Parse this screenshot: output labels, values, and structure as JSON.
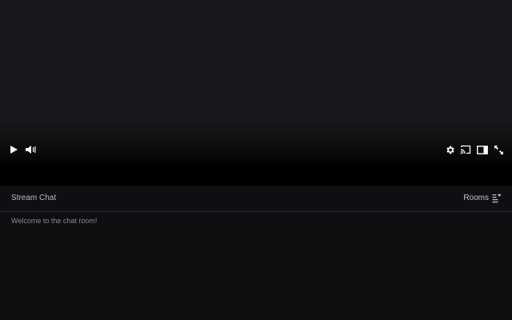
{
  "player": {
    "controls": {
      "play_icon": "play-icon",
      "volume_icon": "volume-icon",
      "settings_icon": "gear-icon",
      "cast_icon": "cast-icon",
      "theatre_icon": "theatre-mode-icon",
      "fullscreen_icon": "fullscreen-icon"
    }
  },
  "chat": {
    "title": "Stream Chat",
    "rooms_label": "Rooms",
    "messages": [
      "Welcome to the chat room!"
    ]
  },
  "colors": {
    "player_bg": "#19181c",
    "chat_bg": "#0e0e11",
    "header_border": "#2a2740",
    "text": "#b9b6c2",
    "muted_text": "#8b8794"
  }
}
